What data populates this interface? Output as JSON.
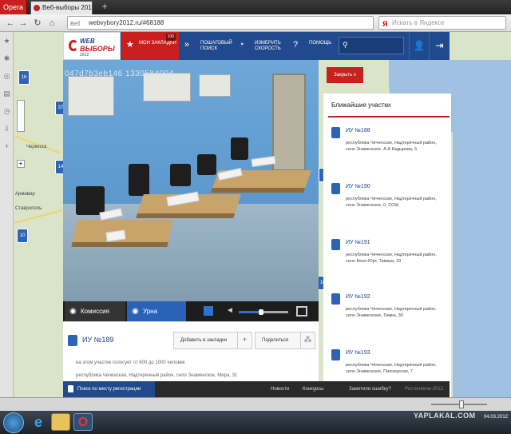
{
  "browser": {
    "menu_label": "Opera",
    "tabs": [
      {
        "label": "Веб-выборы 2012"
      }
    ],
    "new_tab": "+",
    "url": "webvybory2012.ru/#68188",
    "url_badge": "Веб",
    "search_placeholder": "Искать в Яндексе",
    "search_engine_glyph": "Я"
  },
  "site": {
    "logo": {
      "line1": "WEB",
      "line2": "ВЫБОРЫ",
      "line3": "2012"
    },
    "nav": [
      {
        "label": "Мои закладки",
        "icon": "star-icon",
        "count": "106"
      },
      {
        "label": "Пошаговый поиск",
        "icon": "steps-icon"
      },
      {
        "label": "Измерить скорость",
        "icon": "speedometer-icon"
      },
      {
        "label": "Помощь",
        "icon": "help-icon"
      }
    ]
  },
  "video": {
    "overlay_code": "047d7b3eb146 1330584004",
    "controls": {
      "commission": "Комиссия",
      "urn": "Урна",
      "volume": 0.45
    }
  },
  "station": {
    "title": "ИУ №189",
    "add_bookmark": "Добавить в закладки",
    "share": "Поделиться",
    "voters_text": "на этом участке голосует от 600 до 1000 человек",
    "address": "республика Чеченская, Надтеречный район, село Знаменское, Мира, 31"
  },
  "nearby": {
    "close_label": "Закрыть x",
    "title": "Ближайшие участки",
    "items": [
      {
        "name": "ИУ №188",
        "address": "республика Чеченская, Надтеречный район, село Знаменское, А.А.Кадырова, 6"
      },
      {
        "name": "ИУ №190",
        "address": "республика Чеченская, Надтеречный район, село Знаменское, 0, СОШ"
      },
      {
        "name": "ИУ №191",
        "address": "республика Чеченская, Надтеречный район, село Бено-Юрт, Тамаза, 33"
      },
      {
        "name": "ИУ №192",
        "address": "республика Чеченская, Надтеречный район, село Знаменское, Тимка, 30"
      },
      {
        "name": "ИУ №193",
        "address": "республика Чеченская, Надтеречный район, село Знаменское, Пионерская, 7"
      }
    ]
  },
  "footer": {
    "search_label": "Поиск по месту регистрации",
    "news": "Новости",
    "contests": "Конкурсы",
    "report": "Заметили ошибку?",
    "copyright": "Ростелеком 2012"
  },
  "map_pins": [
    "16",
    "37",
    "10",
    "14",
    "10",
    "5"
  ],
  "map_labels": [
    "Черкесск",
    "Армавир",
    "Ставрополь"
  ],
  "taskbar": {
    "date": "04.03.2012",
    "watermark": "YAPLAKAL.COM"
  }
}
